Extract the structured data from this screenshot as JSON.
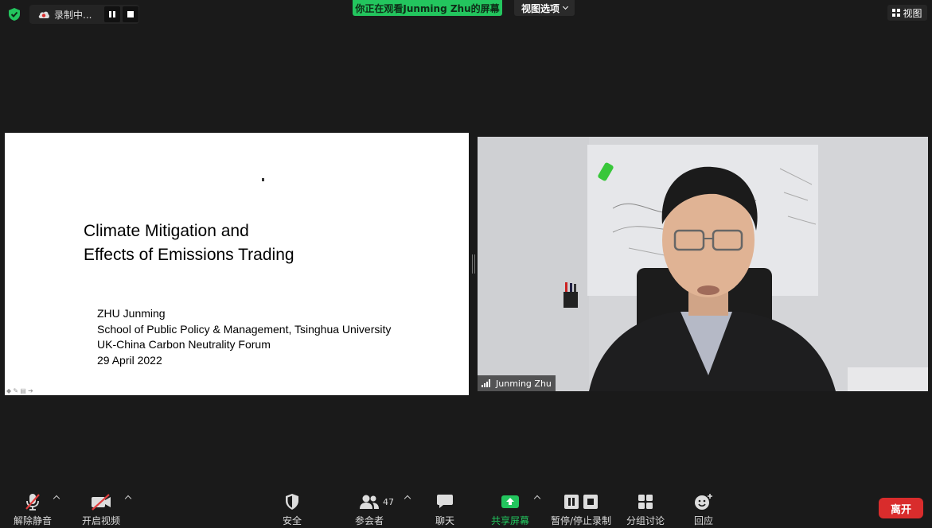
{
  "recording": {
    "status": "录制中..."
  },
  "banner": {
    "viewing_text": "你正在观看Junming Zhu的屏幕",
    "view_options": "视图选项"
  },
  "top_right": {
    "view_label": "视图"
  },
  "slide": {
    "title_line1": "Climate Mitigation and",
    "title_line2": "Effects of Emissions Trading",
    "author": "ZHU Junming",
    "affiliation": "School of Public Policy & Management, Tsinghua University",
    "event": "UK-China Carbon Neutrality Forum",
    "date": "29 April 2022"
  },
  "video": {
    "participant_name": "Junming Zhu"
  },
  "toolbar": {
    "unmute": "解除静音",
    "start_video": "开启视频",
    "security": "安全",
    "participants": "参会者",
    "participants_count": "47",
    "chat": "聊天",
    "share_screen": "共享屏幕",
    "pause_stop_record": "暂停/停止录制",
    "breakout": "分组讨论",
    "reactions": "回应",
    "leave": "离开"
  },
  "colors": {
    "accent_green": "#23c55e",
    "leave_red": "#d92c2c",
    "background": "#1a1a1a"
  }
}
